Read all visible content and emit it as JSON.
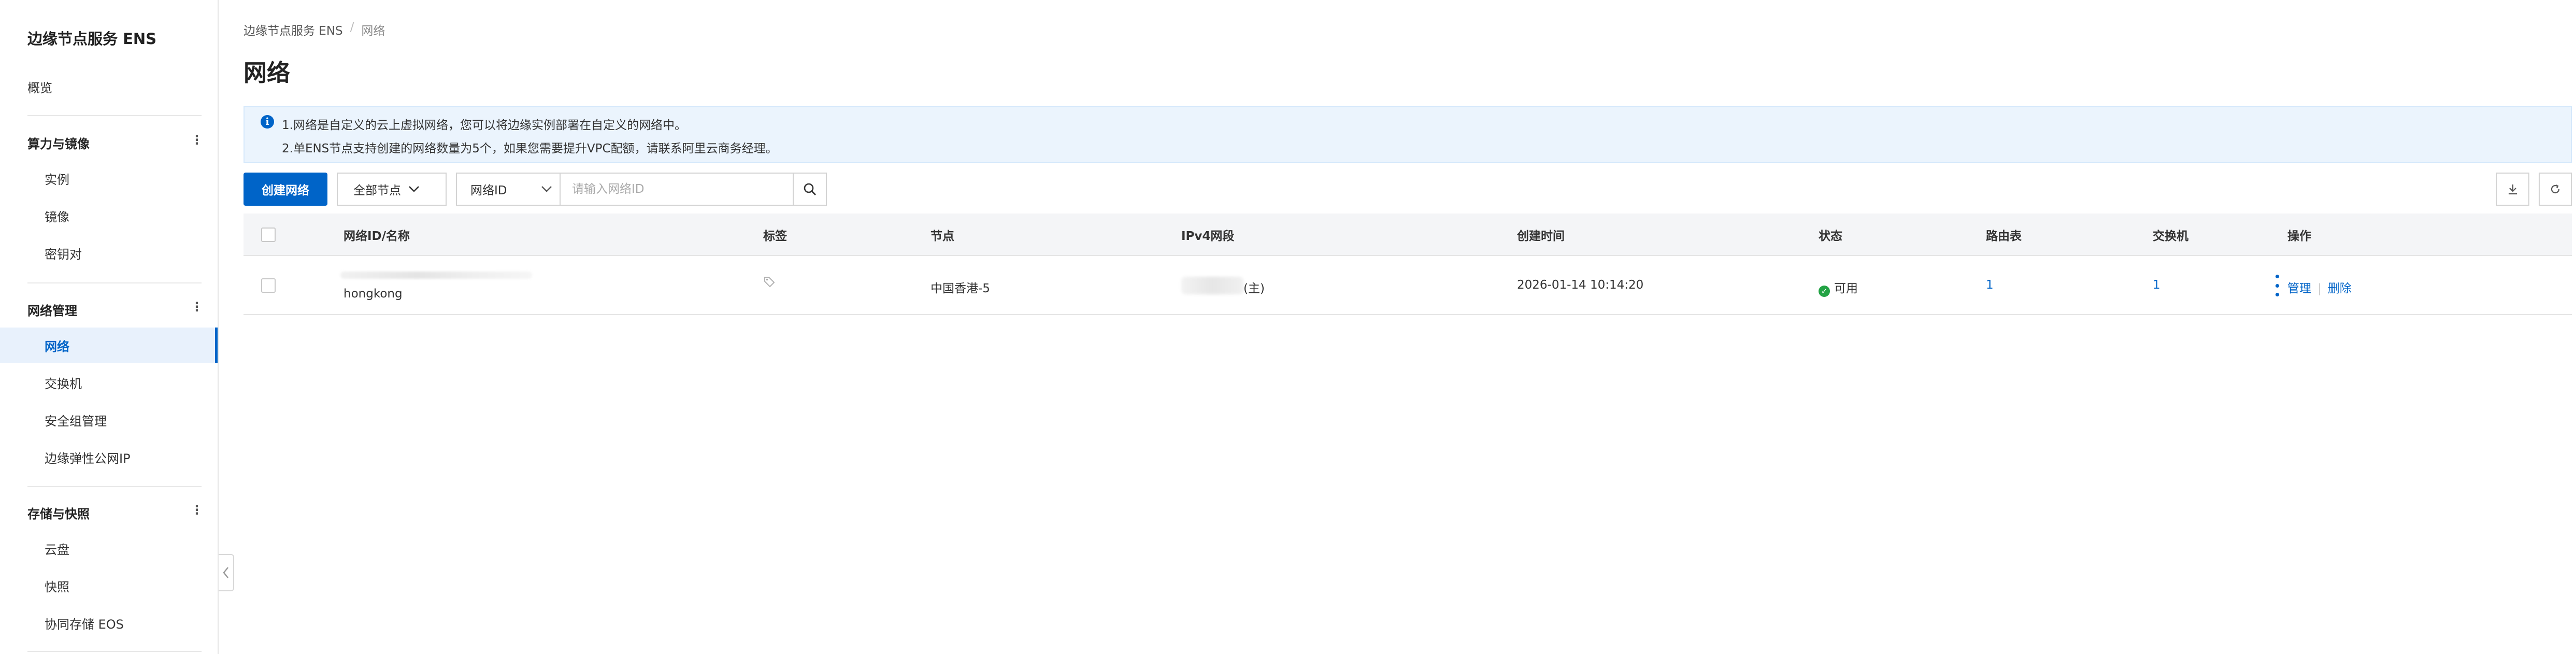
{
  "sidebar": {
    "title": "边缘节点服务 ENS",
    "overview": "概览",
    "groups": [
      {
        "label": "算力与镜像",
        "items": [
          "实例",
          "镜像",
          "密钥对"
        ]
      },
      {
        "label": "网络管理",
        "items": [
          "网络",
          "交换机",
          "安全组管理",
          "边缘弹性公网IP"
        ]
      },
      {
        "label": "存储与快照",
        "items": [
          "云盘",
          "快照",
          "协同存储 EOS"
        ]
      }
    ],
    "active_item": "网络"
  },
  "breadcrumb": {
    "root": "边缘节点服务 ENS",
    "separator": "/",
    "current": "网络"
  },
  "page_title": "网络",
  "notice": {
    "line1": "1.网络是自定义的云上虚拟网络，您可以将边缘实例部署在自定义的网络中。",
    "line2": "2.单ENS节点支持创建的网络数量为5个，如果您需要提升VPC配额，请联系阿里云商务经理。"
  },
  "toolbar": {
    "create_label": "创建网络",
    "node_filter": "全部节点",
    "search_field": "网络ID",
    "search_placeholder": "请输入网络ID"
  },
  "table": {
    "columns": [
      "网络ID/名称",
      "标签",
      "节点",
      "IPv4网段",
      "创建时间",
      "状态",
      "路由表",
      "交换机",
      "操作"
    ],
    "rows": [
      {
        "name": "hongkong",
        "node": "中国香港-5",
        "ipv4_suffix": "(主)",
        "created": "2026-01-14 10:14:20",
        "status": "可用",
        "route_tables": "1",
        "switches": "1",
        "action_manage": "管理",
        "action_delete": "删除"
      }
    ]
  },
  "colors": {
    "primary": "#0064c8",
    "notice_bg": "#ebf4fd",
    "status_ok": "#23a345"
  }
}
